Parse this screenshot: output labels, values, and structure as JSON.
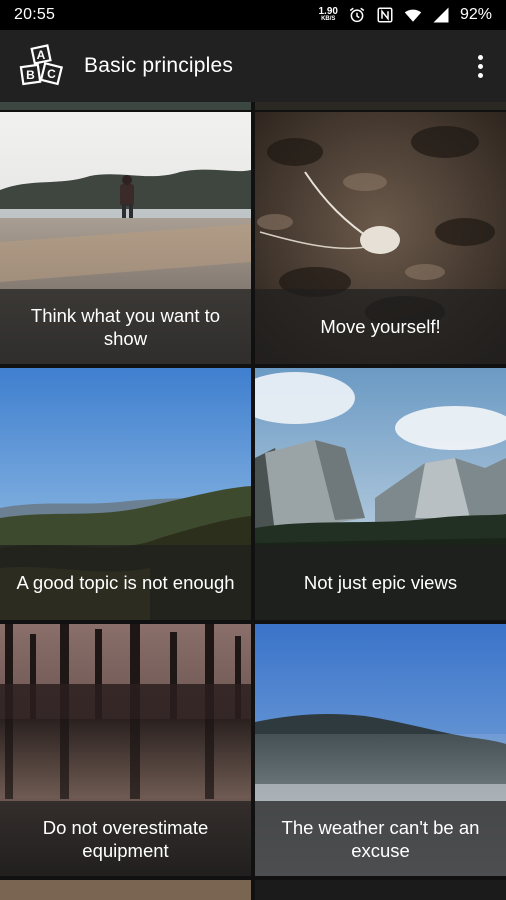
{
  "status_bar": {
    "time": "20:55",
    "net_speed_value": "1.90",
    "net_speed_unit": "KB/S",
    "icons": [
      "alarm-icon",
      "nfc-icon",
      "wifi-icon",
      "cell-signal-icon"
    ],
    "battery": "92%"
  },
  "app_bar": {
    "logo_icon": "abc-blocks-icon",
    "logo_letters": [
      "A",
      "B",
      "C"
    ],
    "title": "Basic principles",
    "menu_icon": "more-vert-icon"
  },
  "tiles": [
    {
      "caption": "Think what you want to show"
    },
    {
      "caption": "Move yourself!"
    },
    {
      "caption": "A good topic is not enough"
    },
    {
      "caption": "Not just epic views"
    },
    {
      "caption": "Do not overestimate equipment"
    },
    {
      "caption": "The weather can't be an excuse"
    }
  ],
  "colors": {
    "status_bar_bg": "#000000",
    "app_bar_bg": "#212121",
    "caption_bg": "rgba(30,30,30,0.72)",
    "text": "#ffffff"
  }
}
